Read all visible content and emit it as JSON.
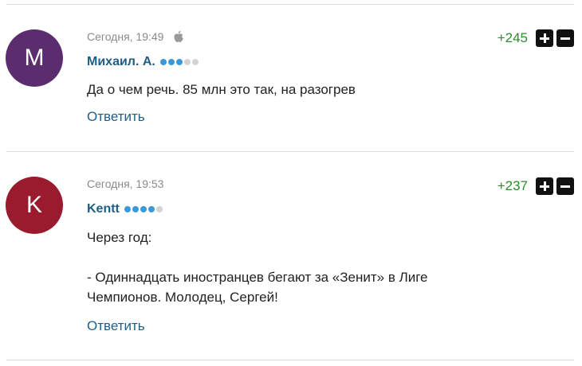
{
  "comments": [
    {
      "avatar_letter": "М",
      "avatar_color": "#5b2d6e",
      "timestamp": "Сегодня, 19:49",
      "device_icon": "apple-icon",
      "author": "Михаил. А.",
      "rank_filled": 3,
      "rank_total": 5,
      "score": "+245",
      "text_lines": [
        "Да о чем речь. 85 млн это так, на разогрев"
      ],
      "reply_label": "Ответить"
    },
    {
      "avatar_letter": "K",
      "avatar_color": "#9b1b2e",
      "timestamp": "Сегодня, 19:53",
      "author": "Kentt",
      "rank_filled": 4,
      "rank_total": 5,
      "score": "+237",
      "text_lines": [
        "Через год:",
        "",
        "- Одиннадцать иностранцев бегают за «Зенит» в Лиге",
        "Чемпионов. Молодец, Сергей!"
      ],
      "reply_label": "Ответить"
    }
  ],
  "colors": {
    "author": "#1e5e86",
    "score": "#2e8b2e",
    "rank_filled": "#3a9ad9",
    "rank_empty": "#d4d4d4"
  }
}
